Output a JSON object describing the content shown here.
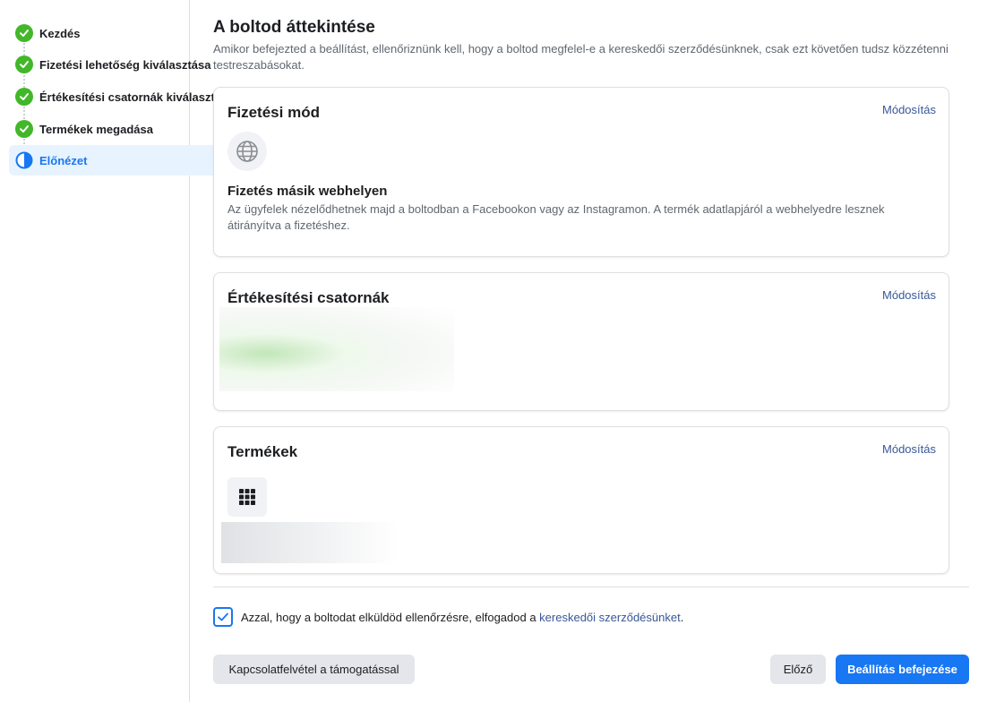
{
  "steps": [
    {
      "label": "Kezdés",
      "state": "done"
    },
    {
      "label": "Fizetési lehetőség kiválasztása",
      "state": "done"
    },
    {
      "label": "Értékesítési csatornák kiválasztása",
      "state": "done"
    },
    {
      "label": "Termékek megadása",
      "state": "done"
    },
    {
      "label": "Előnézet",
      "state": "active"
    }
  ],
  "main": {
    "title": "A boltod áttekintése",
    "subtitle": "Amikor befejezted a beállítást, ellenőriznünk kell, hogy a boltod megfelel-e a kereskedői szerződésünknek, csak ezt követően tudsz közzétenni testreszabásokat."
  },
  "cards": {
    "payment": {
      "title": "Fizetési mód",
      "edit": "Módosítás",
      "icon": "globe-icon",
      "method_title": "Fizetés másik webhelyen",
      "method_desc": "Az ügyfelek nézelődhetnek majd a boltodban a Facebookon vagy az Instagramon. A termék adatlapjáról a webhelyedre lesznek átirányítva a fizetéshez."
    },
    "channels": {
      "title": "Értékesítési csatornák",
      "edit": "Módosítás"
    },
    "products": {
      "title": "Termékek",
      "edit": "Módosítás",
      "icon": "grid-icon"
    }
  },
  "agreement": {
    "checked": true,
    "text": "Azzal, hogy a boltodat elküldöd ellenőrzésre, elfogadod a ",
    "link": "kereskedői szerződésünket",
    "suffix": "."
  },
  "buttons": {
    "support": "Kapcsolatfelvétel a támogatással",
    "previous": "Előző",
    "finish": "Beállítás befejezése"
  },
  "colors": {
    "accent": "#1877f2",
    "success": "#42b72a",
    "link": "#385898"
  }
}
